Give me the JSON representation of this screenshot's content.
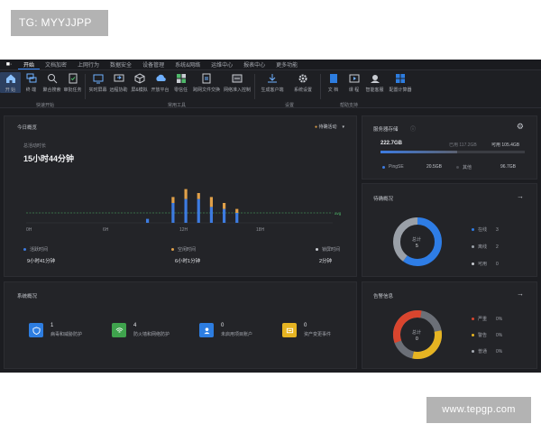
{
  "watermarks": {
    "top": "TG: MYYJJPP",
    "bottom": "www.tepgp.com"
  },
  "menu": {
    "logo": "■·",
    "items": [
      "开始",
      "文档加密",
      "上网行为",
      "数据安全",
      "设备管理",
      "系统&网络",
      "运维中心",
      "报表中心",
      "更多功能"
    ]
  },
  "ribbon": {
    "buttons": [
      "开 始",
      "终 端",
      "聚合搜索",
      "审批任务",
      "实时屏幕",
      "远程协助",
      "屏&模拟",
      "开放平台",
      "零信任",
      "跨网文件交换",
      "网络准入控制",
      "生成客户端",
      "系统设置",
      "文 档",
      "课 程",
      "智能客服",
      "配置计算器"
    ],
    "groups": [
      "快速开始",
      "常用工具",
      "设置",
      "帮助支持"
    ]
  },
  "today": {
    "title": "今日概览",
    "filter": "待确活动",
    "metric_label": "总活动时长",
    "metric_value": "15小时44分钟",
    "avg_label": "avg",
    "legend": [
      {
        "name": "活跃时间",
        "value": "9小时41分钟",
        "color": "#3d7be0"
      },
      {
        "name": "空闲时间",
        "value": "6小时1分钟",
        "color": "#e0a049"
      },
      {
        "name": "锁屏时间",
        "value": "2分钟",
        "color": "#c9ccd2"
      }
    ]
  },
  "chart_data": {
    "type": "bar",
    "xticks": [
      "0H",
      "6H",
      "12H",
      "18H"
    ],
    "categories": [
      0,
      1,
      2,
      3,
      4,
      5,
      6,
      7,
      8,
      9,
      10,
      11,
      12,
      13,
      14,
      15,
      16,
      17,
      18,
      19,
      20,
      21,
      22,
      23
    ],
    "series": [
      {
        "name": "活跃时间",
        "color": "#3d7be0",
        "values": [
          0,
          0,
          0,
          0,
          0,
          0,
          0,
          0,
          0,
          0.1,
          0,
          0.5,
          0.6,
          0.6,
          0.4,
          0.35,
          0.25,
          0,
          0,
          0,
          0,
          0,
          0,
          0
        ]
      },
      {
        "name": "空闲时间",
        "color": "#e0a049",
        "values": [
          0,
          0,
          0,
          0,
          0,
          0,
          0,
          0,
          0,
          0,
          0,
          0.15,
          0.25,
          0.15,
          0.25,
          0.15,
          0.1,
          0,
          0,
          0,
          0,
          0,
          0,
          0
        ]
      }
    ],
    "avg": 0.25
  },
  "storage": {
    "title": "服务器存储",
    "total": "222.7GB",
    "used_label": "已用 117.2GB",
    "free_label": "可用 105.4GB",
    "used_fraction": 0.53,
    "items": [
      {
        "name": "PingSE",
        "value": "20.5GB",
        "color": "#3d7be0"
      },
      {
        "name": "其他",
        "value": "96.7GB",
        "color": "#4a4c52"
      }
    ]
  },
  "pending": {
    "title": "待确概况",
    "center_label": "总计",
    "center_value": "5",
    "items": [
      {
        "name": "在线",
        "value": "3",
        "color": "#2e7de6"
      },
      {
        "name": "离线",
        "value": "2",
        "color": "#9aa0a8"
      },
      {
        "name": "可用",
        "value": "0",
        "color": "#c9ccd2"
      }
    ]
  },
  "system": {
    "title": "系统概况",
    "items": [
      {
        "value": "1",
        "label": "病毒和威胁防护",
        "color": "#2d7de0",
        "icon": "shield-icon"
      },
      {
        "value": "4",
        "label": "防火墙和网络防护",
        "color": "#3fa34d",
        "icon": "wifi-icon"
      },
      {
        "value": "0",
        "label": "未启用项目账户",
        "color": "#2d7de0",
        "icon": "user-icon"
      },
      {
        "value": "0",
        "label": "资产变更事件",
        "color": "#e6b422",
        "icon": "hardware-icon"
      }
    ]
  },
  "alerts": {
    "title": "告警信息",
    "center_label": "总计",
    "center_value": "0",
    "items": [
      {
        "name": "严重",
        "value": "0%",
        "color": "#d9452e"
      },
      {
        "name": "警告",
        "value": "0%",
        "color": "#e6b422"
      },
      {
        "name": "普通",
        "value": "0%",
        "color": "#a6abb3"
      }
    ]
  }
}
